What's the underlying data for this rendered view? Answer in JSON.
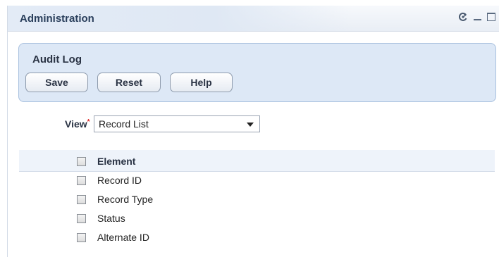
{
  "portlet": {
    "title": "Administration"
  },
  "audit_panel": {
    "title": "Audit Log",
    "buttons": {
      "save": "Save",
      "reset": "Reset",
      "help": "Help"
    }
  },
  "view": {
    "label": "View",
    "required_marker": "*",
    "selected": "Record List"
  },
  "table": {
    "header": "Element",
    "rows": [
      "Record ID",
      "Record Type",
      "Status",
      "Alternate ID"
    ]
  },
  "colors": {
    "panel_bg": "#dde8f6",
    "panel_border": "#a9c1df",
    "required": "#dd2222"
  },
  "icons": [
    "refresh-icon",
    "minimize-icon",
    "maximize-icon",
    "dropdown-arrow-icon"
  ]
}
